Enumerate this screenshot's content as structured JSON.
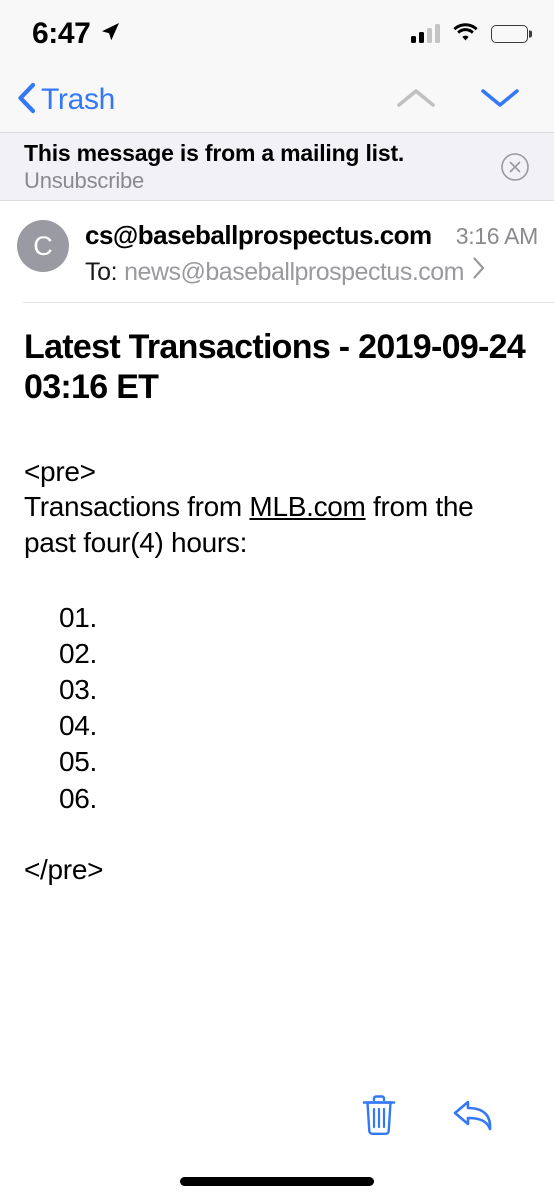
{
  "status_bar": {
    "time": "6:47",
    "location_icon": "location-arrow-icon",
    "signal_icon": "cellular-signal-icon",
    "signal_bars_filled": 2,
    "signal_bars_total": 4,
    "wifi_icon": "wifi-icon",
    "battery_icon": "battery-icon",
    "battery_level_percent": 88
  },
  "nav_bar": {
    "back_label": "Trash",
    "back_icon": "chevron-left-icon",
    "prev_message_icon": "chevron-up-icon",
    "next_message_icon": "chevron-down-icon",
    "prev_enabled": false,
    "next_enabled": true
  },
  "banner": {
    "title": "This message is from a mailing list.",
    "action_label": "Unsubscribe",
    "close_icon": "close-circle-icon"
  },
  "message_header": {
    "avatar_initial": "C",
    "sender": "cs@baseballprospectus.com",
    "time": "3:16 AM",
    "to_label": "To:",
    "to_address": "news@baseballprospectus.com",
    "details_icon": "chevron-right-icon"
  },
  "message": {
    "subject": "Latest Transactions - 2019-09-24 03:16 ET",
    "open_tag": "<pre>",
    "intro_before_link": "Transactions from ",
    "intro_link": "MLB.com",
    "intro_after_link": " from the past four(4) hours:",
    "transactions": [
      "01.",
      "02.",
      "03.",
      "04.",
      "05.",
      "06."
    ],
    "close_tag": "</pre>"
  },
  "toolbar": {
    "delete_icon": "trash-icon",
    "reply_icon": "reply-arrow-icon"
  },
  "colors": {
    "accent_blue": "#3478f6",
    "disabled_gray": "#c0c0c2",
    "banner_bg": "#f2f2f6",
    "chrome_bg": "#f8f8f8",
    "avatar_bg": "#9a9aa2",
    "secondary_text": "#8a8a8e"
  }
}
